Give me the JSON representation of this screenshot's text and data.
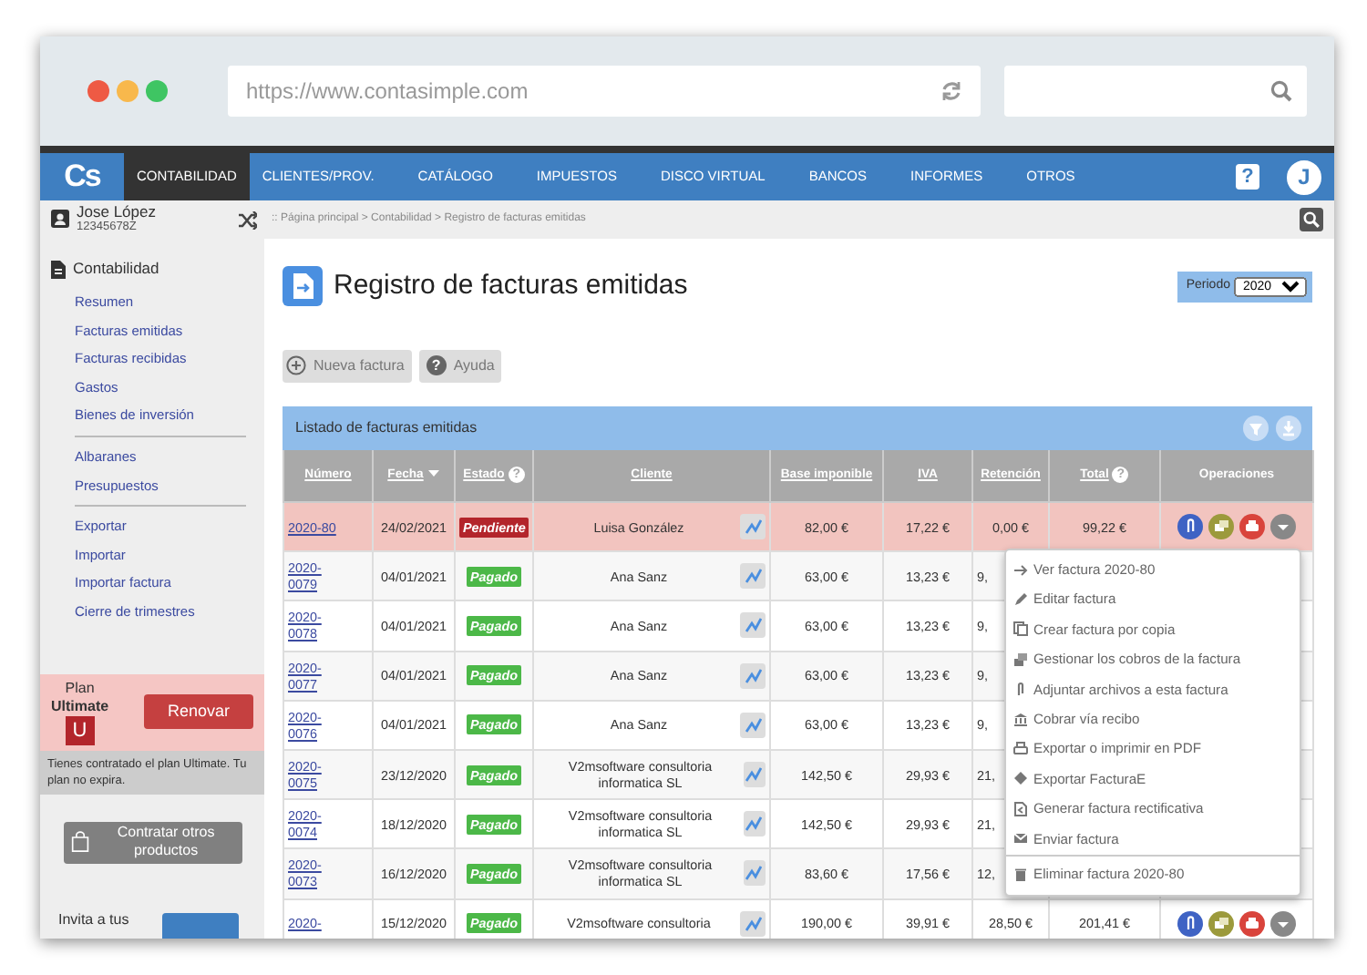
{
  "browser": {
    "url": "https://www.contasimple.com"
  },
  "nav": {
    "logo": "Cs",
    "items": [
      {
        "label": "CONTABILIDAD",
        "selected": true
      },
      {
        "label": "CLIENTES/PROV.",
        "selected": false
      },
      {
        "label": "CATÁLOGO",
        "selected": false
      },
      {
        "label": "IMPUESTOS",
        "selected": false
      },
      {
        "label": "DISCO VIRTUAL",
        "selected": false
      },
      {
        "label": "BANCOS",
        "selected": false
      },
      {
        "label": "INFORMES",
        "selected": false
      },
      {
        "label": "OTROS",
        "selected": false
      }
    ],
    "help": "?",
    "avatar": "J"
  },
  "user": {
    "name": "Jose López",
    "id": "12345678Z"
  },
  "breadcrumb": ":: Página principal > Contabilidad > Registro de facturas emitidas",
  "sidebar": {
    "heading": "Contabilidad",
    "groups": [
      [
        "Resumen",
        "Facturas emitidas",
        "Facturas recibidas",
        "Gastos",
        "Bienes de inversión"
      ],
      [
        "Albaranes",
        "Presupuestos"
      ],
      [
        "Exportar",
        "Importar",
        "Importar factura",
        "Cierre de trimestres"
      ]
    ],
    "plan": {
      "label": "Plan",
      "name": "Ultimate",
      "badge": "U",
      "button": "Renovar",
      "note": "Tienes contratado el plan Ultimate. Tu plan no expira."
    },
    "products_button": "Contratar otros productos",
    "invite": "Invita a tus"
  },
  "page": {
    "title": "Registro de facturas emitidas",
    "period_label": "Periodo",
    "period": "2020",
    "buttons": [
      {
        "label": "Nueva factura",
        "kind": "add"
      },
      {
        "label": "Ayuda",
        "kind": "help",
        "mark": "?"
      }
    ]
  },
  "table": {
    "title": "Listado de facturas emitidas",
    "columns": [
      {
        "label": "Número",
        "sorted": false
      },
      {
        "label": "Fecha",
        "sorted": true
      },
      {
        "label": "Estado",
        "sorted": false,
        "help": "?"
      },
      {
        "label": "Cliente",
        "sorted": false
      },
      {
        "label": "Base imponible",
        "sorted": false
      },
      {
        "label": "IVA",
        "sorted": false
      },
      {
        "label": "Retención",
        "sorted": false
      },
      {
        "label": "Total",
        "sorted": false,
        "help": "?"
      },
      {
        "label": "Operaciones",
        "sorted": false
      }
    ],
    "rows": [
      {
        "number": "2020-80",
        "date": "24/02/2021",
        "status": "Pendiente",
        "color": "#b3252b",
        "client": "Luisa González",
        "base": "82,00 €",
        "iva": "17,22 €",
        "retention": "0,00 €",
        "total": "99,22 €",
        "selected": true
      },
      {
        "number": "2020-0079",
        "date": "04/01/2021",
        "status": "Pagado",
        "color": "#4cb848",
        "client": "Ana Sanz",
        "base": "63,00 €",
        "iva": "13,23 €",
        "retention": "9,",
        "selected": false
      },
      {
        "number": "2020-0078",
        "date": "04/01/2021",
        "status": "Pagado",
        "color": "#4cb848",
        "client": "Ana Sanz",
        "base": "63,00 €",
        "iva": "13,23 €",
        "retention": "9,",
        "selected": false
      },
      {
        "number": "2020-0077",
        "date": "04/01/2021",
        "status": "Pagado",
        "color": "#4cb848",
        "client": "Ana Sanz",
        "base": "63,00 €",
        "iva": "13,23 €",
        "retention": "9,",
        "selected": false
      },
      {
        "number": "2020-0076",
        "date": "04/01/2021",
        "status": "Pagado",
        "color": "#4cb848",
        "client": "Ana Sanz",
        "base": "63,00 €",
        "iva": "13,23 €",
        "retention": "9,",
        "selected": false
      },
      {
        "number": "2020-0075",
        "date": "23/12/2020",
        "status": "Pagado",
        "color": "#4cb848",
        "client": "V2msoftware consultoria informatica SL",
        "base": "142,50 €",
        "iva": "29,93 €",
        "retention": "21,",
        "selected": false
      },
      {
        "number": "2020-0074",
        "date": "18/12/2020",
        "status": "Pagado",
        "color": "#4cb848",
        "client": "V2msoftware consultoria informatica SL",
        "base": "142,50 €",
        "iva": "29,93 €",
        "retention": "21,",
        "selected": false
      },
      {
        "number": "2020-0073",
        "date": "16/12/2020",
        "status": "Pagado",
        "color": "#4cb848",
        "client": "V2msoftware consultoria informatica SL",
        "base": "83,60 €",
        "iva": "17,56 €",
        "retention": "12,",
        "selected": false
      },
      {
        "number": "2020-",
        "date": "15/12/2020",
        "status": "Pagado",
        "color": "#4cb848",
        "client": "V2msoftware consultoria",
        "base": "190,00 €",
        "iva": "39,91 €",
        "retention": "28,50 €",
        "total": "201,41 €",
        "selected": false
      }
    ]
  },
  "menu": {
    "groups": [
      [
        {
          "label": "Ver factura 2020-80",
          "kind": "arrow"
        },
        {
          "label": "Editar factura",
          "kind": "pencil"
        },
        {
          "label": "Crear factura por copia",
          "kind": "copy"
        },
        {
          "label": "Gestionar los cobros de la factura",
          "kind": "coins"
        },
        {
          "label": "Adjuntar archivos a esta factura",
          "kind": "clip"
        },
        {
          "label": "Cobrar vía recibo",
          "kind": "bank"
        },
        {
          "label": "Exportar o imprimir en PDF",
          "kind": "print"
        },
        {
          "label": "Exportar FacturaE",
          "kind": "diamond"
        },
        {
          "label": "Generar factura rectificativa",
          "kind": "doc"
        },
        {
          "label": "Enviar factura",
          "kind": "mail"
        }
      ],
      [
        {
          "label": "Eliminar factura 2020-80",
          "kind": "trash"
        }
      ]
    ]
  }
}
